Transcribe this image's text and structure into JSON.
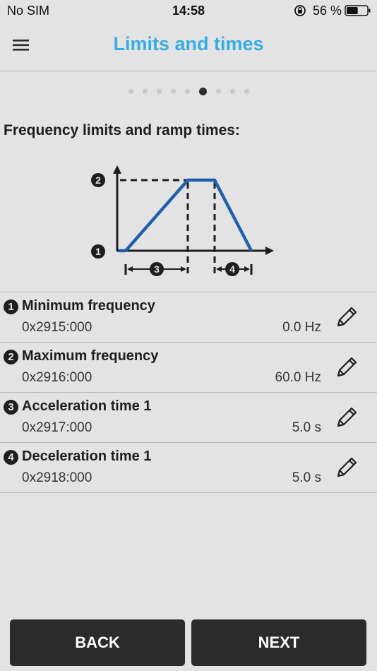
{
  "status_bar": {
    "carrier": "No SIM",
    "time": "14:58",
    "battery_percent": "56 %",
    "battery_level": 0.56
  },
  "header": {
    "title": "Limits and times",
    "menu_icon": "hamburger-menu-icon",
    "accent_color": "#35aee3"
  },
  "pager": {
    "total": 9,
    "active_index": 5
  },
  "section": {
    "heading": "Frequency limits and ramp times:"
  },
  "diagram": {
    "markers": [
      "2",
      "1",
      "3",
      "4"
    ],
    "line_color": "#1e5fae"
  },
  "parameters": [
    {
      "number": "1",
      "title": "Minimum frequency",
      "address": "0x2915:000",
      "value": "0.0 Hz",
      "edit_icon": "pencil-icon"
    },
    {
      "number": "2",
      "title": "Maximum frequency",
      "address": "0x2916:000",
      "value": "60.0 Hz",
      "edit_icon": "pencil-icon"
    },
    {
      "number": "3",
      "title": "Acceleration time 1",
      "address": "0x2917:000",
      "value": "5.0 s",
      "edit_icon": "pencil-icon"
    },
    {
      "number": "4",
      "title": "Deceleration time 1",
      "address": "0x2918:000",
      "value": "5.0 s",
      "edit_icon": "pencil-icon"
    }
  ],
  "footer": {
    "back_label": "BACK",
    "next_label": "NEXT"
  }
}
